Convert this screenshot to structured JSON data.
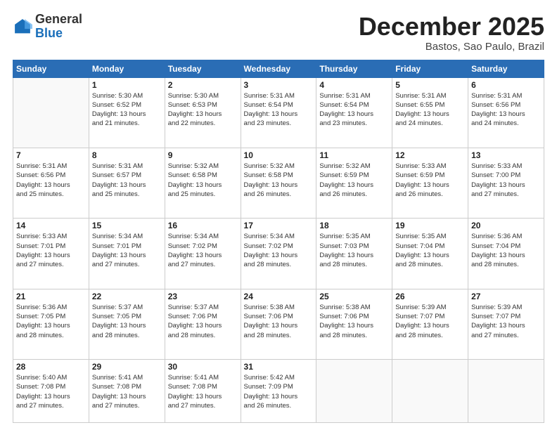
{
  "logo": {
    "general": "General",
    "blue": "Blue"
  },
  "header": {
    "month": "December 2025",
    "location": "Bastos, Sao Paulo, Brazil"
  },
  "weekdays": [
    "Sunday",
    "Monday",
    "Tuesday",
    "Wednesday",
    "Thursday",
    "Friday",
    "Saturday"
  ],
  "weeks": [
    [
      {
        "day": "",
        "info": ""
      },
      {
        "day": "1",
        "info": "Sunrise: 5:30 AM\nSunset: 6:52 PM\nDaylight: 13 hours\nand 21 minutes."
      },
      {
        "day": "2",
        "info": "Sunrise: 5:30 AM\nSunset: 6:53 PM\nDaylight: 13 hours\nand 22 minutes."
      },
      {
        "day": "3",
        "info": "Sunrise: 5:31 AM\nSunset: 6:54 PM\nDaylight: 13 hours\nand 23 minutes."
      },
      {
        "day": "4",
        "info": "Sunrise: 5:31 AM\nSunset: 6:54 PM\nDaylight: 13 hours\nand 23 minutes."
      },
      {
        "day": "5",
        "info": "Sunrise: 5:31 AM\nSunset: 6:55 PM\nDaylight: 13 hours\nand 24 minutes."
      },
      {
        "day": "6",
        "info": "Sunrise: 5:31 AM\nSunset: 6:56 PM\nDaylight: 13 hours\nand 24 minutes."
      }
    ],
    [
      {
        "day": "7",
        "info": "Sunrise: 5:31 AM\nSunset: 6:56 PM\nDaylight: 13 hours\nand 25 minutes."
      },
      {
        "day": "8",
        "info": "Sunrise: 5:31 AM\nSunset: 6:57 PM\nDaylight: 13 hours\nand 25 minutes."
      },
      {
        "day": "9",
        "info": "Sunrise: 5:32 AM\nSunset: 6:58 PM\nDaylight: 13 hours\nand 25 minutes."
      },
      {
        "day": "10",
        "info": "Sunrise: 5:32 AM\nSunset: 6:58 PM\nDaylight: 13 hours\nand 26 minutes."
      },
      {
        "day": "11",
        "info": "Sunrise: 5:32 AM\nSunset: 6:59 PM\nDaylight: 13 hours\nand 26 minutes."
      },
      {
        "day": "12",
        "info": "Sunrise: 5:33 AM\nSunset: 6:59 PM\nDaylight: 13 hours\nand 26 minutes."
      },
      {
        "day": "13",
        "info": "Sunrise: 5:33 AM\nSunset: 7:00 PM\nDaylight: 13 hours\nand 27 minutes."
      }
    ],
    [
      {
        "day": "14",
        "info": "Sunrise: 5:33 AM\nSunset: 7:01 PM\nDaylight: 13 hours\nand 27 minutes."
      },
      {
        "day": "15",
        "info": "Sunrise: 5:34 AM\nSunset: 7:01 PM\nDaylight: 13 hours\nand 27 minutes."
      },
      {
        "day": "16",
        "info": "Sunrise: 5:34 AM\nSunset: 7:02 PM\nDaylight: 13 hours\nand 27 minutes."
      },
      {
        "day": "17",
        "info": "Sunrise: 5:34 AM\nSunset: 7:02 PM\nDaylight: 13 hours\nand 28 minutes."
      },
      {
        "day": "18",
        "info": "Sunrise: 5:35 AM\nSunset: 7:03 PM\nDaylight: 13 hours\nand 28 minutes."
      },
      {
        "day": "19",
        "info": "Sunrise: 5:35 AM\nSunset: 7:04 PM\nDaylight: 13 hours\nand 28 minutes."
      },
      {
        "day": "20",
        "info": "Sunrise: 5:36 AM\nSunset: 7:04 PM\nDaylight: 13 hours\nand 28 minutes."
      }
    ],
    [
      {
        "day": "21",
        "info": "Sunrise: 5:36 AM\nSunset: 7:05 PM\nDaylight: 13 hours\nand 28 minutes."
      },
      {
        "day": "22",
        "info": "Sunrise: 5:37 AM\nSunset: 7:05 PM\nDaylight: 13 hours\nand 28 minutes."
      },
      {
        "day": "23",
        "info": "Sunrise: 5:37 AM\nSunset: 7:06 PM\nDaylight: 13 hours\nand 28 minutes."
      },
      {
        "day": "24",
        "info": "Sunrise: 5:38 AM\nSunset: 7:06 PM\nDaylight: 13 hours\nand 28 minutes."
      },
      {
        "day": "25",
        "info": "Sunrise: 5:38 AM\nSunset: 7:06 PM\nDaylight: 13 hours\nand 28 minutes."
      },
      {
        "day": "26",
        "info": "Sunrise: 5:39 AM\nSunset: 7:07 PM\nDaylight: 13 hours\nand 28 minutes."
      },
      {
        "day": "27",
        "info": "Sunrise: 5:39 AM\nSunset: 7:07 PM\nDaylight: 13 hours\nand 27 minutes."
      }
    ],
    [
      {
        "day": "28",
        "info": "Sunrise: 5:40 AM\nSunset: 7:08 PM\nDaylight: 13 hours\nand 27 minutes."
      },
      {
        "day": "29",
        "info": "Sunrise: 5:41 AM\nSunset: 7:08 PM\nDaylight: 13 hours\nand 27 minutes."
      },
      {
        "day": "30",
        "info": "Sunrise: 5:41 AM\nSunset: 7:08 PM\nDaylight: 13 hours\nand 27 minutes."
      },
      {
        "day": "31",
        "info": "Sunrise: 5:42 AM\nSunset: 7:09 PM\nDaylight: 13 hours\nand 26 minutes."
      },
      {
        "day": "",
        "info": ""
      },
      {
        "day": "",
        "info": ""
      },
      {
        "day": "",
        "info": ""
      }
    ]
  ]
}
